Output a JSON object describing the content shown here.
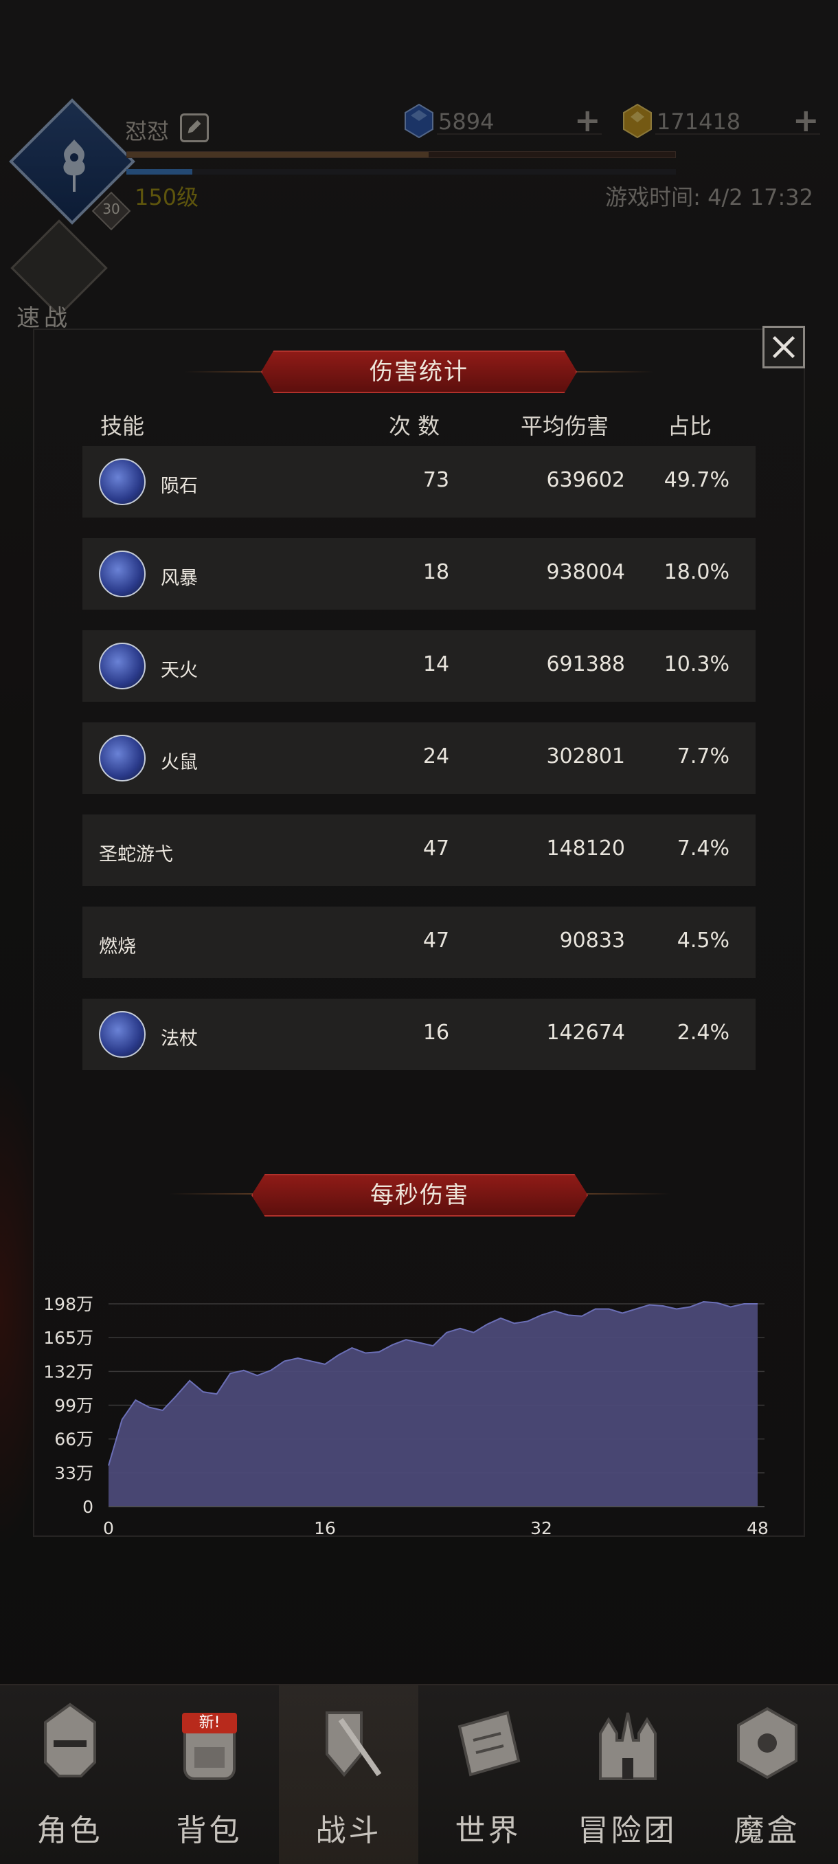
{
  "header": {
    "player_name": "怼怼",
    "avatar_level": "30",
    "level_label": "150级",
    "game_time": "游戏时间: 4/2 17:32",
    "exp_fraction": 0.55,
    "hp_fraction": 0.12,
    "currency_gem": "5894",
    "currency_gold": "171418",
    "quick_battle_label": "速战"
  },
  "damage_stats": {
    "title": "伤害统计",
    "columns": {
      "skill": "技能",
      "count": "次 数",
      "avg_damage": "平均伤害",
      "share": "占比"
    },
    "rows": [
      {
        "name": "陨石",
        "count": "73",
        "avg": "639602",
        "pct": "49.7%",
        "has_icon": true
      },
      {
        "name": "风暴",
        "count": "18",
        "avg": "938004",
        "pct": "18.0%",
        "has_icon": true
      },
      {
        "name": "天火",
        "count": "14",
        "avg": "691388",
        "pct": "10.3%",
        "has_icon": true
      },
      {
        "name": "火鼠",
        "count": "24",
        "avg": "302801",
        "pct": "7.7%",
        "has_icon": true
      },
      {
        "name": "圣蛇游弋",
        "count": "47",
        "avg": "148120",
        "pct": "7.4%",
        "has_icon": false
      },
      {
        "name": "燃烧",
        "count": "47",
        "avg": "90833",
        "pct": "4.5%",
        "has_icon": false
      },
      {
        "name": "法杖",
        "count": "16",
        "avg": "142674",
        "pct": "2.4%",
        "has_icon": true
      }
    ]
  },
  "dps_section": {
    "title": "每秒伤害"
  },
  "chart_data": {
    "type": "area",
    "title": "每秒伤害",
    "xlabel": "",
    "ylabel": "",
    "xlim": [
      0,
      48
    ],
    "ylim": [
      0,
      198
    ],
    "x_ticks": [
      "0",
      "16",
      "32",
      "48"
    ],
    "y_ticks": [
      "0",
      "33万",
      "66万",
      "99万",
      "132万",
      "165万",
      "198万"
    ],
    "grid": true,
    "fill_color": "#4c4a78",
    "line_color": "#6b6fb6",
    "series": [
      {
        "x": [
          0,
          1,
          2,
          3,
          4,
          5,
          6,
          7,
          8,
          9,
          10,
          11,
          12,
          13,
          14,
          15,
          16,
          17,
          18,
          19,
          20,
          21,
          22,
          23,
          24,
          25,
          26,
          27,
          28,
          29,
          30,
          31,
          32,
          33,
          34,
          35,
          36,
          37,
          38,
          39,
          40,
          41,
          42,
          43,
          44,
          45,
          46,
          47,
          48
        ],
        "y": [
          40,
          85,
          104,
          97,
          94,
          108,
          123,
          112,
          110,
          130,
          133,
          128,
          133,
          142,
          145,
          142,
          139,
          148,
          155,
          150,
          151,
          158,
          163,
          160,
          157,
          170,
          174,
          170,
          178,
          184,
          179,
          181,
          187,
          191,
          187,
          186,
          193,
          193,
          189,
          193,
          197,
          196,
          193,
          195,
          200,
          199,
          195,
          198,
          198
        ]
      }
    ]
  },
  "bottom_nav": [
    {
      "label": "角色",
      "icon": "helmet-icon",
      "active": false
    },
    {
      "label": "背包",
      "icon": "backpack-icon",
      "active": false,
      "badge": "新!"
    },
    {
      "label": "战斗",
      "icon": "sword-shield-icon",
      "active": true
    },
    {
      "label": "世界",
      "icon": "map-scroll-icon",
      "active": false
    },
    {
      "label": "冒险团",
      "icon": "castle-icon",
      "active": false
    },
    {
      "label": "魔盒",
      "icon": "magic-cube-icon",
      "active": false
    }
  ]
}
